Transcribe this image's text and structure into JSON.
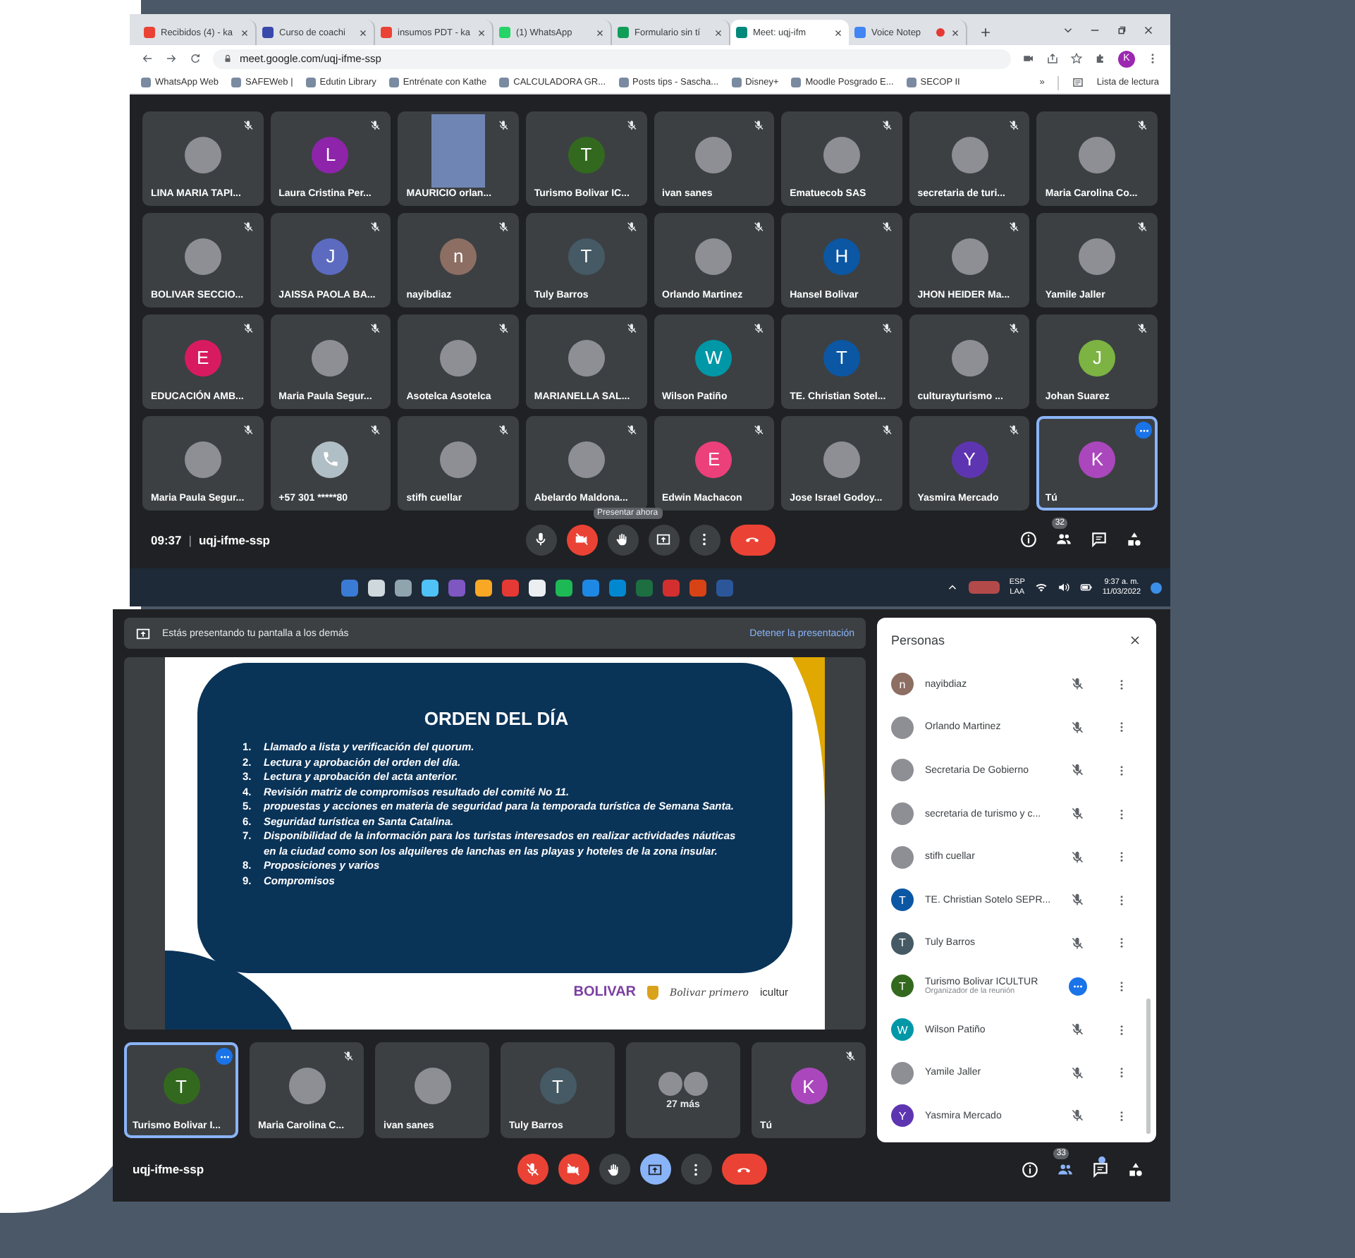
{
  "browser": {
    "tabs": [
      {
        "title": "Recibidos (4) - ka",
        "kind": "mail",
        "selected": false,
        "recording": false
      },
      {
        "title": "Curso de coachi",
        "kind": "edutin",
        "selected": false,
        "recording": false
      },
      {
        "title": "insumos PDT - ka",
        "kind": "mail",
        "selected": false,
        "recording": false
      },
      {
        "title": "(1) WhatsApp",
        "kind": "whatsapp",
        "selected": false,
        "recording": false
      },
      {
        "title": "Formulario sin tí",
        "kind": "sheets",
        "selected": false,
        "recording": false
      },
      {
        "title": "Meet: uqj-ifm",
        "kind": "meet",
        "selected": true,
        "recording": false
      },
      {
        "title": "Voice Notep",
        "kind": "voice",
        "selected": false,
        "recording": true
      }
    ],
    "address": "meet.google.com/uqj-ifme-ssp",
    "profile_initial": "K",
    "bookmarks": [
      "WhatsApp Web",
      "SAFEWeb |",
      "Edutin Library",
      "Entrénate con Kathe",
      "CALCULADORA GR...",
      "Posts tips - Sascha...",
      "Disney+",
      "Moodle Posgrado E...",
      "SECOP II"
    ],
    "bookmarks_overflow": "»",
    "reading_list": "Lista de lectura"
  },
  "meeting_top": {
    "tiles": [
      {
        "name": "LINA MARIA TAPI...",
        "kind": "photo",
        "muted": true,
        "highlighted": false
      },
      {
        "name": "Laura Cristina Per...",
        "kind": "letter",
        "letter": "L",
        "color": "#8e24aa",
        "muted": true,
        "highlighted": false
      },
      {
        "name": "MAURICIO orlan...",
        "kind": "video",
        "muted": true,
        "highlighted": false
      },
      {
        "name": "Turismo Bolivar IC...",
        "kind": "letter",
        "letter": "T",
        "color": "#33691e",
        "muted": true,
        "highlighted": false
      },
      {
        "name": "ivan sanes",
        "kind": "photo",
        "muted": true,
        "highlighted": false
      },
      {
        "name": "Ematuecob SAS",
        "kind": "photo",
        "muted": true,
        "highlighted": false
      },
      {
        "name": "secretaria de turi...",
        "kind": "photo",
        "muted": true,
        "highlighted": false
      },
      {
        "name": "Maria Carolina Co...",
        "kind": "photo",
        "muted": true,
        "highlighted": false
      },
      {
        "name": "BOLIVAR SECCIO...",
        "kind": "photo",
        "muted": true,
        "highlighted": false
      },
      {
        "name": "JAISSA PAOLA BA...",
        "kind": "letter",
        "letter": "J",
        "color": "#5c6bc0",
        "muted": true,
        "highlighted": false
      },
      {
        "name": "nayibdiaz",
        "kind": "letter",
        "letter": "n",
        "color": "#8d6e63",
        "muted": true,
        "highlighted": false
      },
      {
        "name": "Tuly Barros",
        "kind": "letter",
        "letter": "T",
        "color": "#455a64",
        "muted": true,
        "highlighted": false
      },
      {
        "name": "Orlando Martinez",
        "kind": "photo",
        "muted": true,
        "highlighted": false
      },
      {
        "name": "Hansel Bolivar",
        "kind": "letter",
        "letter": "H",
        "color": "#0b57a4",
        "muted": true,
        "highlighted": false
      },
      {
        "name": "JHON HEIDER Ma...",
        "kind": "photo",
        "muted": true,
        "highlighted": false
      },
      {
        "name": "Yamile Jaller",
        "kind": "photo",
        "muted": true,
        "highlighted": false
      },
      {
        "name": "EDUCACIÓN AMB...",
        "kind": "letter",
        "letter": "E",
        "color": "#d81b60",
        "muted": true,
        "highlighted": false
      },
      {
        "name": "Maria Paula Segur...",
        "kind": "photo",
        "muted": true,
        "highlighted": false
      },
      {
        "name": "Asotelca Asotelca",
        "kind": "photo",
        "muted": true,
        "highlighted": false
      },
      {
        "name": "MARIANELLA SAL...",
        "kind": "photo",
        "muted": true,
        "highlighted": false
      },
      {
        "name": "Wilson Patiño",
        "kind": "letter",
        "letter": "W",
        "color": "#0097a7",
        "muted": true,
        "highlighted": false
      },
      {
        "name": "TE. Christian Sotel...",
        "kind": "letter",
        "letter": "T",
        "color": "#0b57a4",
        "muted": true,
        "highlighted": false
      },
      {
        "name": "culturayturismo ...",
        "kind": "photo",
        "muted": true,
        "highlighted": false
      },
      {
        "name": "Johan Suarez",
        "kind": "letter",
        "letter": "J",
        "color": "#7cb342",
        "muted": true,
        "highlighted": false
      },
      {
        "name": "Maria Paula Segur...",
        "kind": "photo",
        "muted": true,
        "highlighted": false
      },
      {
        "name": "+57 301 *****80",
        "kind": "phone",
        "muted": true,
        "highlighted": false
      },
      {
        "name": "stifh cuellar",
        "kind": "photo",
        "muted": true,
        "highlighted": false
      },
      {
        "name": "Abelardo Maldona...",
        "kind": "photo",
        "muted": true,
        "highlighted": false
      },
      {
        "name": "Edwin Machacon",
        "kind": "letter",
        "letter": "E",
        "color": "#ec407a",
        "muted": true,
        "highlighted": false
      },
      {
        "name": "Jose Israel Godoy...",
        "kind": "photo",
        "muted": true,
        "highlighted": false
      },
      {
        "name": "Yasmira Mercado",
        "kind": "letter",
        "letter": "Y",
        "color": "#5e35b1",
        "muted": true,
        "highlighted": false
      },
      {
        "name": "Tú",
        "kind": "letter",
        "letter": "K",
        "color": "#ab47bc",
        "muted": false,
        "highlighted": true
      }
    ],
    "time": "09:37",
    "separator": "|",
    "code": "uqj-ifme-ssp",
    "tooltip": "Presentar ahora",
    "controls": [
      {
        "kind": "mic",
        "off": false
      },
      {
        "kind": "camera",
        "off": true
      },
      {
        "kind": "hand"
      },
      {
        "kind": "present",
        "active": false
      },
      {
        "kind": "more"
      },
      {
        "kind": "hangup"
      }
    ],
    "people_count": "32",
    "people_open": false,
    "chat_unread": false
  },
  "taskbar": {
    "language": "ESP",
    "layout": "LAA",
    "time": "9:37 a. m.",
    "date": "11/03/2022"
  },
  "meeting_bottom": {
    "banner": "Estás presentando tu pantalla a los demás",
    "stop_button": "Detener la presentación",
    "slide": {
      "title": "ORDEN DEL DÍA",
      "items": [
        {
          "number": "1.",
          "text": "Llamado a lista y verificación del quorum."
        },
        {
          "number": "2.",
          "text": "Lectura y aprobación del orden del día."
        },
        {
          "number": "3.",
          "text": "Lectura y aprobación del acta anterior."
        },
        {
          "number": "4.",
          "text": "Revisión matriz de compromisos resultado del comité No 11."
        },
        {
          "number": "5.",
          "text": "propuestas y acciones en materia de seguridad para la temporada turística de Semana Santa."
        },
        {
          "number": "6.",
          "text": "Seguridad turística en Santa Catalina."
        },
        {
          "number": "7.",
          "text": "Disponibilidad de la información para los turistas interesados en realizar actividades náuticas en la ciudad como son los alquileres de lanchas en las playas y hoteles de la zona insular."
        },
        {
          "number": "8.",
          "text": "Proposiciones y varios"
        },
        {
          "number": "9.",
          "text": "Compromisos"
        }
      ],
      "logos": [
        {
          "kind": "wordmark",
          "text": "BOLIVAR"
        },
        {
          "kind": "crest"
        },
        {
          "kind": "script",
          "text": "Bolivar primero"
        },
        {
          "kind": "icultur",
          "text": "icultur"
        }
      ]
    },
    "filmstrip": [
      {
        "kind": "letter",
        "name": "Turismo Bolivar I...",
        "letter": "T",
        "color": "#33691e",
        "muted": false,
        "highlighted": true
      },
      {
        "kind": "photo",
        "name": "Maria Carolina C...",
        "muted": true,
        "highlighted": false
      },
      {
        "kind": "photo",
        "name": "ivan sanes",
        "muted": false,
        "highlighted": false
      },
      {
        "kind": "letter",
        "name": "Tuly Barros",
        "letter": "T",
        "color": "#455a64",
        "muted": false,
        "highlighted": false
      },
      {
        "kind": "overflow",
        "label": "27 más"
      },
      {
        "kind": "letter",
        "name": "Tú",
        "letter": "K",
        "color": "#ab47bc",
        "muted": true,
        "highlighted": false
      }
    ],
    "code": "uqj-ifme-ssp",
    "controls": [
      {
        "kind": "mic",
        "off": true
      },
      {
        "kind": "camera",
        "off": true
      },
      {
        "kind": "hand"
      },
      {
        "kind": "present",
        "active": true
      },
      {
        "kind": "more"
      },
      {
        "kind": "hangup"
      }
    ],
    "people_count": "33",
    "people_open": true,
    "chat_unread": true
  },
  "people_panel": {
    "title": "Personas",
    "people": [
      {
        "name": "nayibdiaz",
        "kind": "letter",
        "letter": "n",
        "color": "#8d6e63",
        "muted": true
      },
      {
        "name": "Orlando Martinez",
        "kind": "photo",
        "muted": true
      },
      {
        "name": "Secretaria De Gobierno",
        "kind": "photo",
        "muted": true
      },
      {
        "name": "secretaria de turismo y c...",
        "kind": "photo",
        "muted": true
      },
      {
        "name": "stifh cuellar",
        "kind": "photo",
        "muted": true
      },
      {
        "name": "TE. Christian Sotelo SEPR...",
        "kind": "letter",
        "letter": "T",
        "color": "#0b57a4",
        "muted": true
      },
      {
        "name": "Tuly Barros",
        "kind": "letter",
        "letter": "T",
        "color": "#455a64",
        "muted": true
      },
      {
        "name": "Turismo Bolivar ICULTUR",
        "subtitle": "Organizador de la reunión",
        "kind": "letter",
        "letter": "T",
        "color": "#33691e",
        "muted": false
      },
      {
        "name": "Wilson Patiño",
        "kind": "letter",
        "letter": "W",
        "color": "#0097a7",
        "muted": true
      },
      {
        "name": "Yamile Jaller",
        "kind": "photo",
        "muted": true
      },
      {
        "name": "Yasmira Mercado",
        "kind": "letter",
        "letter": "Y",
        "color": "#5e35b1",
        "muted": true
      }
    ]
  }
}
